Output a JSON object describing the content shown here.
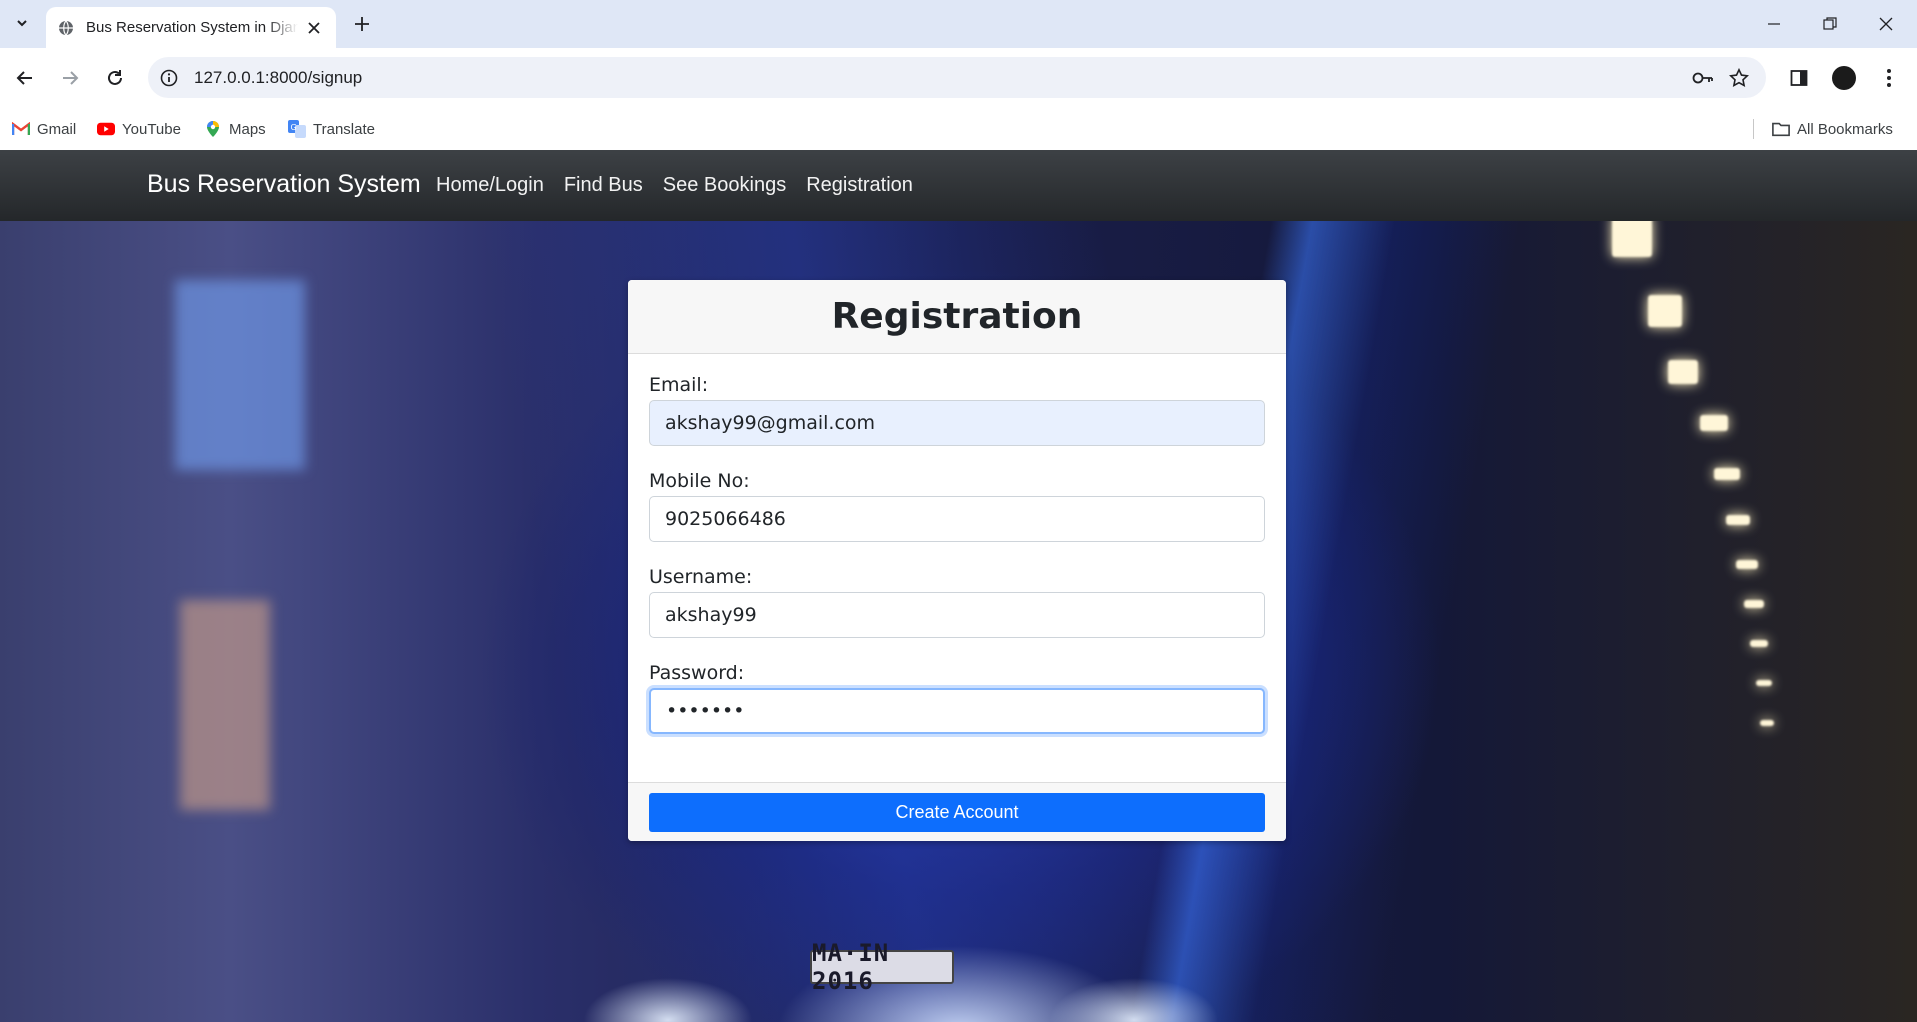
{
  "browser": {
    "tab_title": "Bus Reservation System in Django",
    "url": "127.0.0.1:8000/signup",
    "bookmarks": [
      {
        "label": "Gmail",
        "icon": "gmail-icon"
      },
      {
        "label": "YouTube",
        "icon": "youtube-icon"
      },
      {
        "label": "Maps",
        "icon": "maps-icon"
      },
      {
        "label": "Translate",
        "icon": "translate-icon"
      }
    ],
    "all_bookmarks_label": "All Bookmarks"
  },
  "navbar": {
    "brand": "Bus Reservation System",
    "links": [
      "Home/Login",
      "Find Bus",
      "See Bookings",
      "Registration"
    ]
  },
  "form": {
    "title": "Registration",
    "fields": [
      {
        "label": "Email:",
        "value": "akshay99@gmail.com"
      },
      {
        "label": "Mobile No:",
        "value": "9025066486"
      },
      {
        "label": "Username:",
        "value": "akshay99"
      },
      {
        "label": "Password:",
        "value": "•••••••"
      }
    ],
    "submit_label": "Create Account"
  },
  "background": {
    "plate_text": "MA·IN 2016"
  },
  "colors": {
    "primary": "#0d6efd",
    "navbar": "#343a40",
    "tabstrip": "#dfe7f6"
  }
}
